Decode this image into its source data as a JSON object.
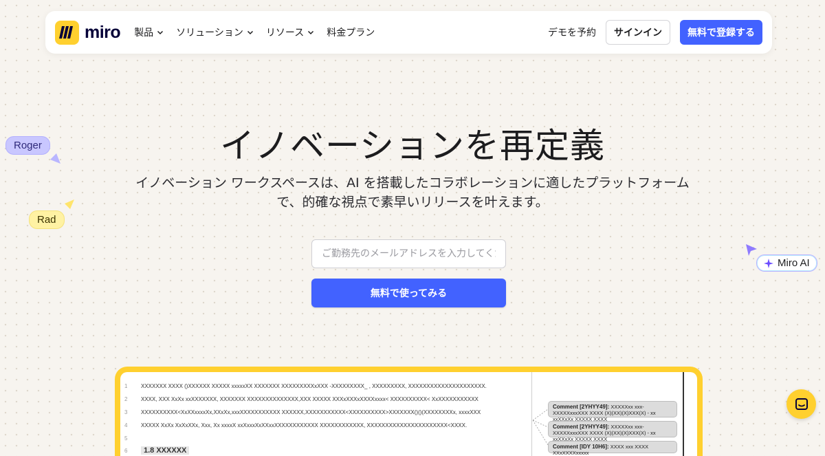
{
  "brand": {
    "name": "miro",
    "color": "#ffd02f",
    "accent": "#4262ff"
  },
  "nav": {
    "items": [
      {
        "label": "製品",
        "has_dropdown": true
      },
      {
        "label": "ソリューション",
        "has_dropdown": true
      },
      {
        "label": "リソース",
        "has_dropdown": true
      },
      {
        "label": "料金プラン",
        "has_dropdown": false
      }
    ],
    "demo": "デモを予約",
    "signin": "サインイン",
    "register": "無料で登録する"
  },
  "hero": {
    "title": "イノベーションを再定義",
    "subtitle_line1": "イノベーション ワークスペースは、AI を搭載したコラボレーションに適したプラットフォーム",
    "subtitle_line2": "で、的確な視点で素早いリリースを叶えます。",
    "email_placeholder": "ご勤務先のメールアドレスを入力してください",
    "cta": "無料で使ってみる"
  },
  "cursors": {
    "roger": "Roger",
    "rad": "Rad",
    "ai": "Miro AI"
  },
  "preview": {
    "lines": [
      {
        "num": "1",
        "text": "XXXXXXX XXXX ()XXXXXX XXXXX xxxxxXX XXXXXXX XXXXXXXXXxXXX -XXXXXXXXX_ , XXXXXXXXX, XXXXXXXXXXXXXXXXXXXXX."
      },
      {
        "num": "2",
        "text": "XXXX, XXX  XxXx xxXXXXXXX, XXXXXXX XXXXXXXXXXXXXX,XXX XXXXX XXXxXXXxXXXXxxxx< XXXXXXXXXX< XxXXXXXXXXXXX"
      },
      {
        "num": "3",
        "text": "XXXXXXXXXX<XxXXxxxxXx,XXxXx,xxxXXXXXXXXXXX XXXXXX,XXXXXXXXXXX<XXXXXXXXXX>XXXXXXX()()(XXXXXXXXx,  xxxxXXX"
      },
      {
        "num": "4",
        "text": "XXXXX XxXx XxXxXXx, Xxx, Xx xxxxX xxXxxxXxXXxxXXXXXXXXXXXX XXXXXXXXXXXX, XXXXXXXXXXXXXXXXXXXXXX<XXXX."
      },
      {
        "num": "5",
        "text": ""
      },
      {
        "num": "6",
        "text": "1.8 XXXXXX"
      }
    ],
    "comments": [
      {
        "author": "Comment [2YHYY49]:",
        "text": "XXXXXxx xxx- XXXXXxxxXXX XXXX (X)(XX)(X)XXX(X) - xx xxXXxXx XXXXX XXXX"
      },
      {
        "author": "Comment [2YHYY49]:",
        "text": "XXXXXxx xxx- XXXXXxxxXXX XXXX (X)(XX)(X)XXX(X) - xx xxXXxXx XXXXX XXXX"
      },
      {
        "author": "Comment [IDY 10H6]:",
        "text": "XXXX xxx XXXX XXxXXXXxxxxx"
      }
    ]
  }
}
